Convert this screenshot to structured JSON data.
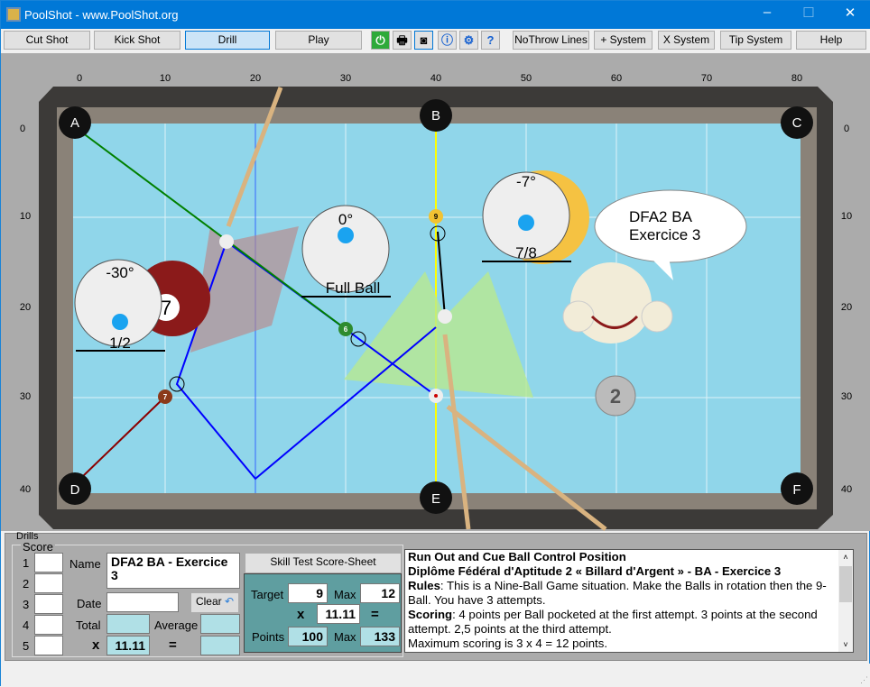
{
  "window": {
    "title": "PoolShot - www.PoolShot.org",
    "minimize": "–",
    "maximize": "☐",
    "close": "✕"
  },
  "toolbar": {
    "buttons": [
      "Cut Shot",
      "Kick Shot",
      "Drill",
      "Play"
    ],
    "active": "Drill",
    "icons": [
      "power-icon",
      "print-icon",
      "camera-icon",
      "info-icon",
      "settings-icon",
      "help-doc-icon"
    ],
    "right_buttons": [
      "NoThrow Lines",
      "+ System",
      "X System",
      "Tip System",
      "Help"
    ]
  },
  "table": {
    "x_ticks": [
      "0",
      "10",
      "20",
      "30",
      "40",
      "50",
      "60",
      "70",
      "80"
    ],
    "y_ticks": [
      "0",
      "10",
      "20",
      "30",
      "40"
    ],
    "pockets": [
      "A",
      "B",
      "C",
      "D",
      "E",
      "F"
    ],
    "balls": {
      "nine": "9",
      "six": "6",
      "seven": "7",
      "big_seven": "7"
    },
    "aims": [
      {
        "angle": "0°",
        "fraction": "Full Ball"
      },
      {
        "angle": "-30°",
        "fraction": "1/2"
      },
      {
        "angle": "-7°",
        "fraction": "7/8"
      }
    ],
    "bubble": [
      "DFA2 BA",
      "Exercice 3"
    ],
    "medal": "2",
    "colors": {
      "cloth": "#8fd4ea",
      "path": "#0000ff",
      "aim_green": "#008000",
      "aim_red": "#8b0000",
      "aim_yellow": "#ffff00"
    }
  },
  "drills": {
    "group": "Drills",
    "score_group": "Score",
    "rows": [
      "1",
      "2",
      "3",
      "4",
      "5"
    ],
    "name_label": "Name",
    "name_value": "DFA2 BA - Exercice 3",
    "date_label": "Date",
    "clear": "Clear",
    "total_label": "Total",
    "average_label": "Average",
    "x": "x",
    "eq": "=",
    "multiplier": "11.11",
    "sheet_button": "Skill Test Score-Sheet",
    "sheet": {
      "target_label": "Target",
      "target": "9",
      "max_label": "Max",
      "max": "12",
      "x": "x",
      "mult": "11.11",
      "eq": "=",
      "points_label": "Points",
      "points": "100",
      "max2": "133"
    }
  },
  "description": {
    "title": "Run Out and Cue Ball Control Position",
    "subtitle": "Diplôme Fédéral d'Aptitude 2 « Billard d'Argent » - BA - Exercice 3",
    "rules_label": "Rules",
    "rules": ": This is a Nine-Ball Game situation. Make the Balls in rotation then the 9-Ball. You have 3 attempts.",
    "scoring_label": "Scoring",
    "scoring": ": 4 points per Ball pocketed at the first attempt. 3 points at the second attempt. 2,5 points at the third attempt.",
    "max": "Maximum scoring is 3 x 4 = 12 points."
  }
}
